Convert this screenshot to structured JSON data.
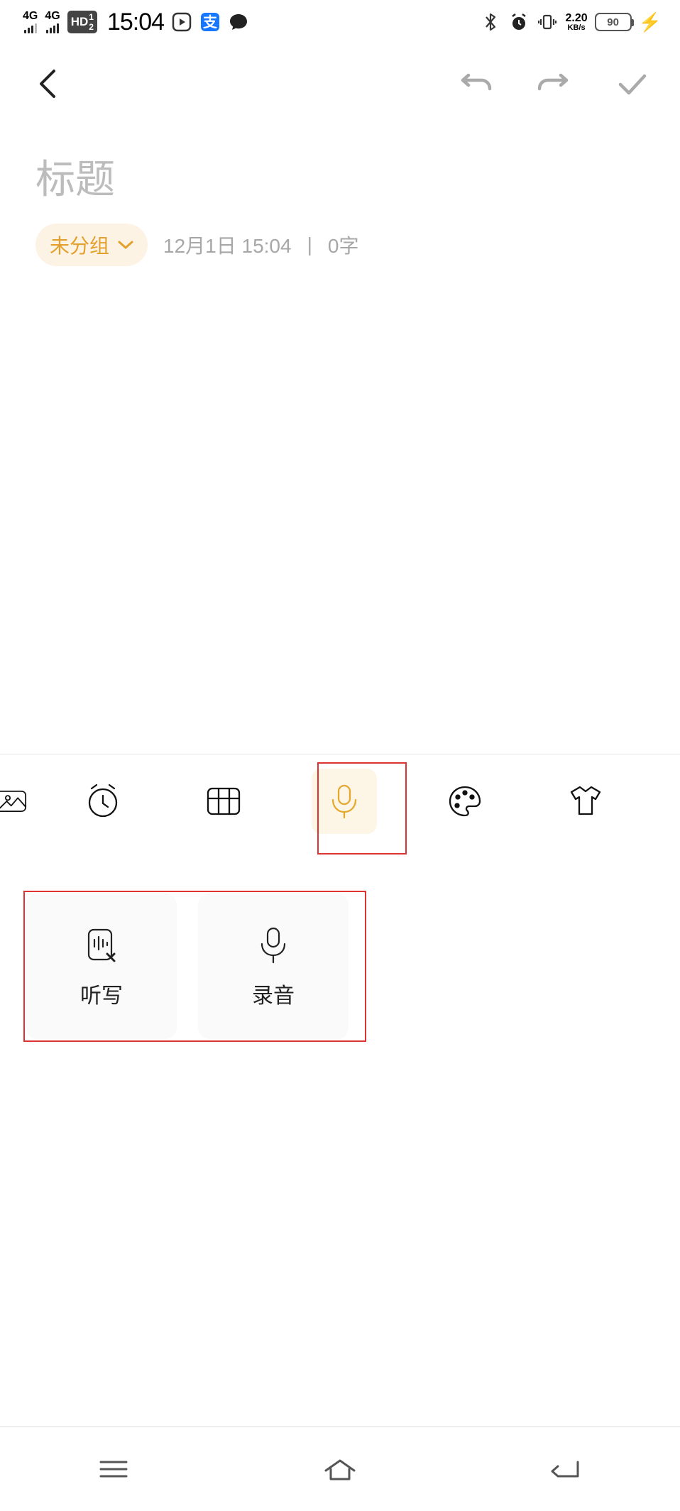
{
  "status": {
    "sig1": "4G",
    "sig2": "4G",
    "hd": "HD",
    "hd_sub": "1\n2",
    "time": "15:04",
    "netrate": "2.20",
    "netunit": "KB/s",
    "battery": "90"
  },
  "note": {
    "title_placeholder": "标题",
    "group_label": "未分组",
    "timestamp": "12月1日 15:04",
    "sep": "|",
    "wordcount": "0字"
  },
  "toolbar": {
    "items": [
      "image",
      "clock",
      "table",
      "mic",
      "palette",
      "shirt"
    ],
    "active": "mic"
  },
  "popup": {
    "dictate": "听写",
    "record": "录音"
  },
  "colors": {
    "accent": "#e5a92e",
    "accent_bg": "#fdf6e6",
    "muted": "#a7a7a7",
    "annotation": "#d33"
  }
}
